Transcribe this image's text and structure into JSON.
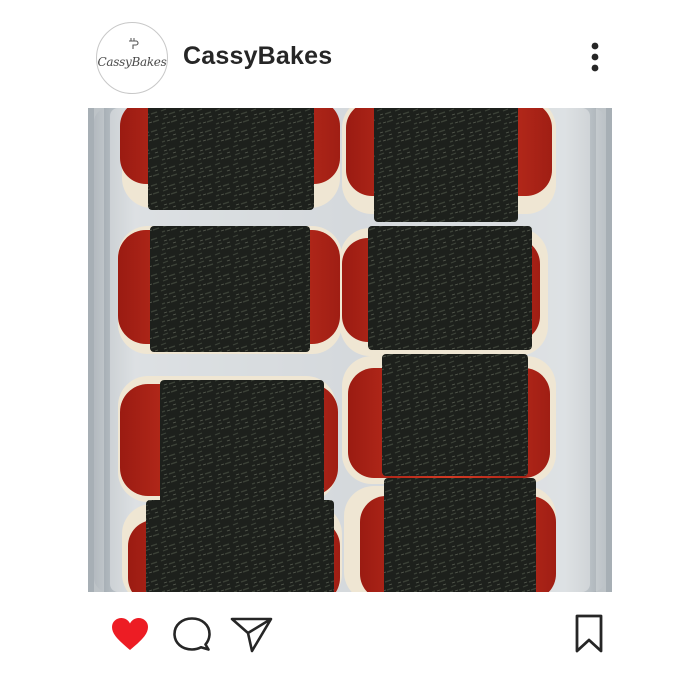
{
  "post": {
    "username": "CassyBakes",
    "avatar_text": "CassyBakes",
    "liked": true,
    "image_alt": "Spam musubi in a glass baking dish"
  },
  "icons": {
    "more": "more-vertical-icon",
    "like": "heart-icon",
    "comment": "comment-bubble-icon",
    "share": "paper-plane-icon",
    "save": "bookmark-icon",
    "avatar_mixer": "hand-mixer-icon"
  },
  "colors": {
    "username": "#262626",
    "like_active": "#ed1c24",
    "icon_stroke": "#262626"
  }
}
